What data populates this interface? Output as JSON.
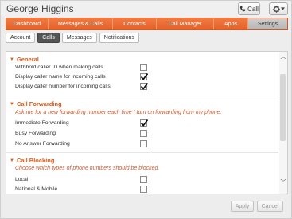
{
  "window": {
    "title": "George Higgins"
  },
  "toolbar": {
    "call_label": "Call"
  },
  "main_nav": [
    {
      "label": "Dashboard",
      "active": false
    },
    {
      "label": "Messages & Calls",
      "active": false
    },
    {
      "label": "Contacts",
      "active": false
    },
    {
      "label": "Call Manager",
      "active": false
    },
    {
      "label": "Apps",
      "active": false
    },
    {
      "label": "Settings",
      "active": true
    }
  ],
  "sub_tabs": [
    {
      "label": "Account",
      "active": false
    },
    {
      "label": "Calls",
      "active": true
    },
    {
      "label": "Messages",
      "active": false
    },
    {
      "label": "Notifications",
      "active": false
    }
  ],
  "sections": {
    "general": {
      "title": "General",
      "rows": [
        {
          "label": "Withhold caller ID when making calls",
          "checked": false
        },
        {
          "label": "Display caller name for incoming calls",
          "checked": true
        },
        {
          "label": "Display caller number for incoming calls",
          "checked": true
        }
      ]
    },
    "forwarding": {
      "title": "Call Forwarding",
      "hint": "Ask me for a new forwarding number each time I turn on forwarding from my phone:",
      "rows": [
        {
          "label": "Immediate Forwarding",
          "checked": true
        },
        {
          "label": "Busy Forwarding",
          "checked": false
        },
        {
          "label": "No Answer Forwarding",
          "checked": false
        }
      ]
    },
    "blocking": {
      "title": "Call Blocking",
      "hint": "Choose which types of phone numbers should be blocked.",
      "rows": [
        {
          "label": "Local",
          "checked": false
        },
        {
          "label": "National & Mobile",
          "checked": false
        }
      ]
    }
  },
  "footer": {
    "apply_label": "Apply",
    "cancel_label": "Cancel"
  },
  "colors": {
    "accent": "#e8692f",
    "section_title": "#e05a1a"
  },
  "icons": {
    "call": "phone-icon",
    "settings": "gear-icon"
  }
}
